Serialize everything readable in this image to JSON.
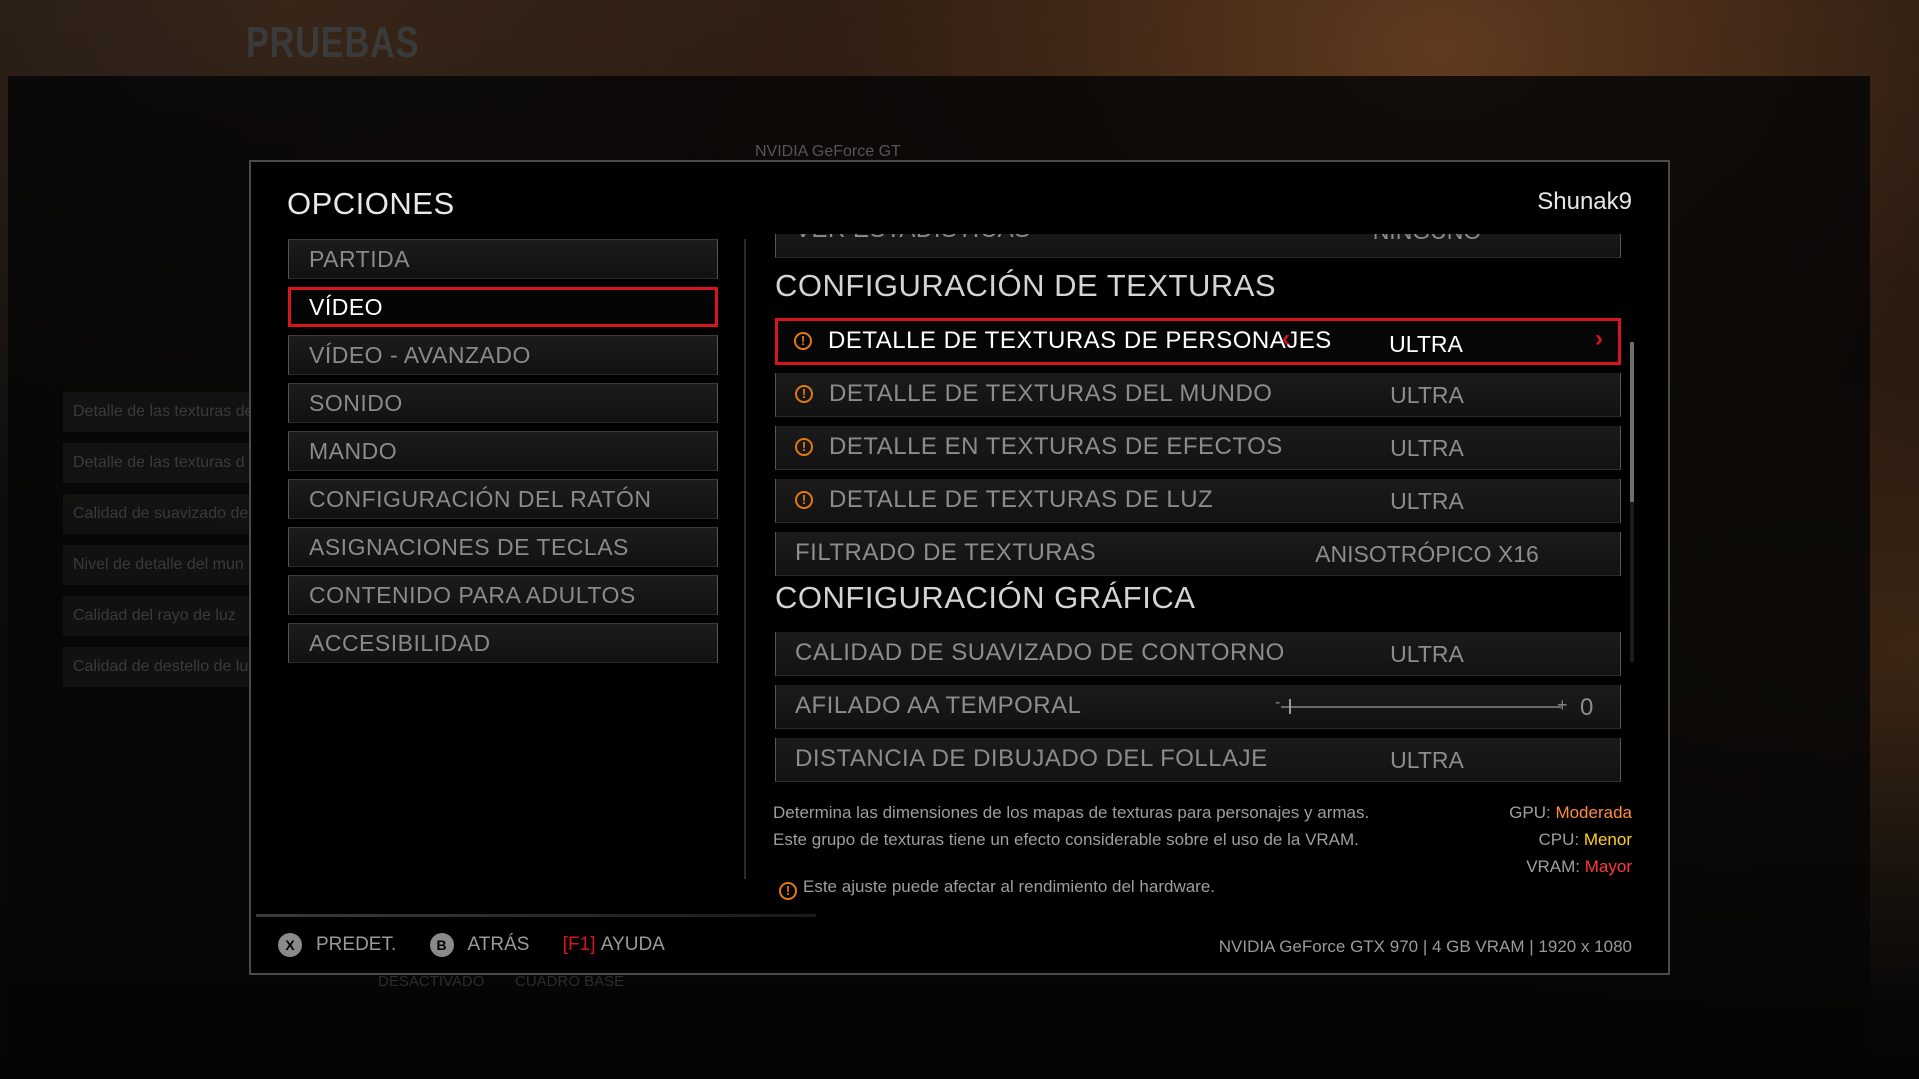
{
  "background": {
    "title": "PRUEBAS",
    "gpu_fragment": "NVIDIA GeForce GT",
    "list": [
      "Detalle de las texturas de",
      "Detalle de las texturas d",
      "Calidad de suavizado de",
      "Nivel de detalle del mun",
      "Calidad del rayo de luz",
      "Calidad de destello de lu"
    ],
    "bottom_left": "DESACTIVADO",
    "bottom_right": "CUADRO BASE"
  },
  "header": {
    "title": "OPCIONES",
    "user": "Shunak9"
  },
  "menu": [
    {
      "label": "PARTIDA"
    },
    {
      "label": "VÍDEO"
    },
    {
      "label": "VÍDEO - AVANZADO"
    },
    {
      "label": "SONIDO"
    },
    {
      "label": "MANDO"
    },
    {
      "label": "CONFIGURACIÓN DEL RATÓN"
    },
    {
      "label": "ASIGNACIONES DE TECLAS"
    },
    {
      "label": "CONTENIDO PARA ADULTOS"
    },
    {
      "label": "ACCESIBILIDAD"
    }
  ],
  "settings": {
    "partial_row": {
      "label": "VER ESTADÍSTICAS",
      "value": "NINGUNO"
    },
    "texture_section": "CONFIGURACIÓN DE TEXTURAS",
    "texture_rows": [
      {
        "label": "DETALLE DE TEXTURAS DE PERSONAJES",
        "value": "ULTRA"
      },
      {
        "label": "DETALLE DE TEXTURAS DEL MUNDO",
        "value": "ULTRA"
      },
      {
        "label": "DETALLE EN TEXTURAS DE EFECTOS",
        "value": "ULTRA"
      },
      {
        "label": "DETALLE DE TEXTURAS DE LUZ",
        "value": "ULTRA"
      },
      {
        "label": "FILTRADO DE TEXTURAS",
        "value": "ANISOTRÓPICO X16"
      }
    ],
    "graphics_section": "CONFIGURACIÓN GRÁFICA",
    "graphics_rows": [
      {
        "label": "CALIDAD DE SUAVIZADO DE CONTORNO",
        "value": "ULTRA"
      },
      {
        "label": "AFILADO AA TEMPORAL",
        "value": "0",
        "minus": "-",
        "plus": "+",
        "slider_level": 0
      },
      {
        "label": "DISTANCIA DE DIBUJADO DEL FOLLAJE",
        "value": "ULTRA"
      }
    ]
  },
  "description": {
    "line1": "Determina las dimensiones de los mapas de texturas para personajes y armas.",
    "line2": "Este grupo de texturas tiene un efecto considerable sobre el uso de la VRAM."
  },
  "impact": [
    {
      "label": "GPU:",
      "value": "Moderada",
      "color": "#ff8c3a"
    },
    {
      "label": "CPU:",
      "value": "Menor",
      "color": "#ffd11a"
    },
    {
      "label": "VRAM:",
      "value": "Mayor",
      "color": "#ff3b3b"
    }
  ],
  "perf_warning": "Este ajuste puede afectar al rendimiento del hardware.",
  "footer": {
    "default": {
      "key": "X",
      "label": "PREDET."
    },
    "back": {
      "key": "B",
      "label": "ATRÁS"
    },
    "help": {
      "key": "F1",
      "label": "AYUDA"
    },
    "gpu_info": "NVIDIA GeForce GTX 970 | 4 GB VRAM | 1920 x 1080"
  },
  "icons": {
    "warning": "!",
    "left_arrow": "‹",
    "right_arrow": "›"
  },
  "accent_color": "#d8141e"
}
